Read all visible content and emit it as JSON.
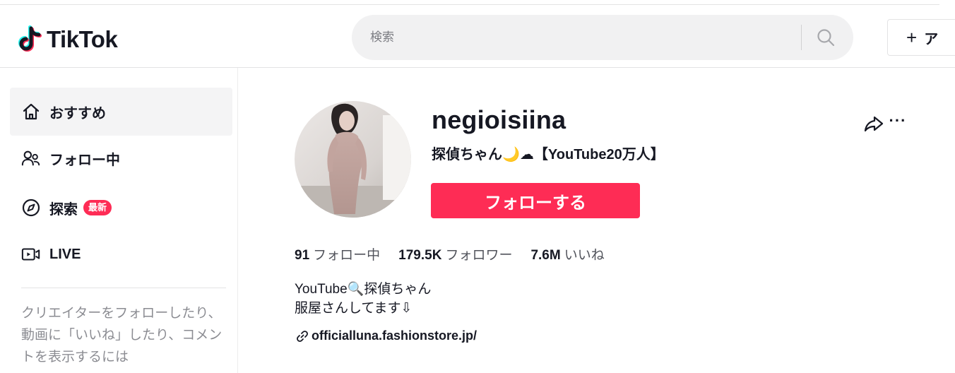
{
  "header": {
    "logo_text": "TikTok",
    "search_placeholder": "検索",
    "upload_label": "ア"
  },
  "sidebar": {
    "items": [
      {
        "label": "おすすめ",
        "icon": "home-icon",
        "active": true
      },
      {
        "label": "フォロー中",
        "icon": "following-icon",
        "active": false
      },
      {
        "label": "探索",
        "icon": "compass-icon",
        "badge": "最新",
        "active": false
      },
      {
        "label": "LIVE",
        "icon": "live-icon",
        "active": false
      }
    ],
    "login_note": "クリエイターをフォローしたり、動画に「いいね」したり、コメントを表示するには"
  },
  "profile": {
    "username": "negioisiina",
    "nickname": "探偵ちゃん🌙☁【YouTube20万人】",
    "follow_label": "フォローする",
    "stats": {
      "following": {
        "value": "91",
        "label": "フォロー中"
      },
      "followers": {
        "value": "179.5K",
        "label": "フォロワー"
      },
      "likes": {
        "value": "7.6M",
        "label": "いいね"
      }
    },
    "bio": [
      "YouTube🔍探偵ちゃん",
      "服屋さんしてます⇩"
    ],
    "link": "officialluna.fashionstore.jp/"
  },
  "colors": {
    "accent": "#fe2c55",
    "text": "#161823",
    "search_bg": "#f1f1f2"
  }
}
